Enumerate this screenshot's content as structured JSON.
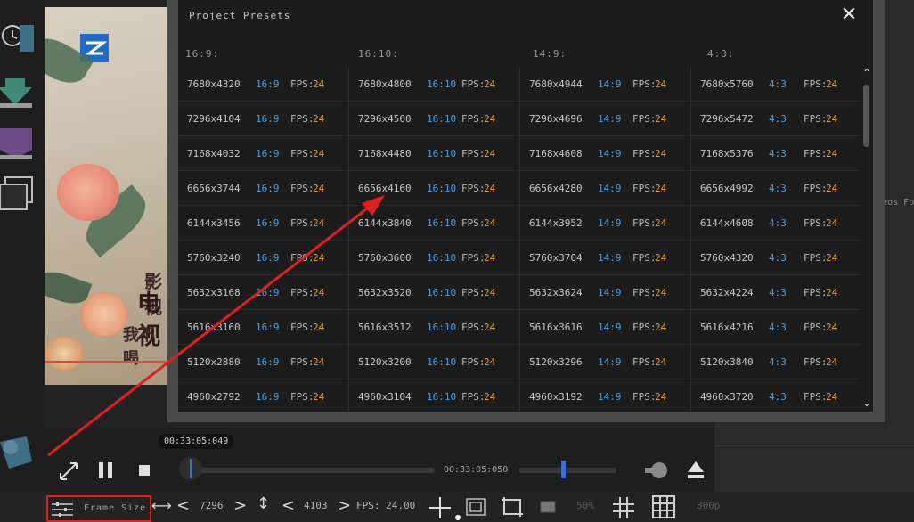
{
  "modal": {
    "title": "Project Presets",
    "close_icon": "close-icon",
    "columns": [
      "16:9:",
      "16:10:",
      "14:9:",
      "4:3:"
    ],
    "fps_label": "FPS:",
    "rows": [
      [
        [
          "7680x4320",
          "16:9",
          "24"
        ],
        [
          "7680x4800",
          "16:10",
          "24"
        ],
        [
          "7680x4944",
          "14:9",
          "24"
        ],
        [
          "7680x5760",
          "4:3",
          "24"
        ]
      ],
      [
        [
          "7296x4104",
          "16:9",
          "24"
        ],
        [
          "7296x4560",
          "16:10",
          "24"
        ],
        [
          "7296x4696",
          "14:9",
          "24"
        ],
        [
          "7296x5472",
          "4:3",
          "24"
        ]
      ],
      [
        [
          "7168x4032",
          "16:9",
          "24"
        ],
        [
          "7168x4480",
          "16:10",
          "24"
        ],
        [
          "7168x4608",
          "14:9",
          "24"
        ],
        [
          "7168x5376",
          "4:3",
          "24"
        ]
      ],
      [
        [
          "6656x3744",
          "16:9",
          "24"
        ],
        [
          "6656x4160",
          "16:10",
          "24"
        ],
        [
          "6656x4280",
          "14:9",
          "24"
        ],
        [
          "6656x4992",
          "4:3",
          "24"
        ]
      ],
      [
        [
          "6144x3456",
          "16:9",
          "24"
        ],
        [
          "6144x3840",
          "16:10",
          "24"
        ],
        [
          "6144x3952",
          "14:9",
          "24"
        ],
        [
          "6144x4608",
          "4:3",
          "24"
        ]
      ],
      [
        [
          "5760x3240",
          "16:9",
          "24"
        ],
        [
          "5760x3600",
          "16:10",
          "24"
        ],
        [
          "5760x3704",
          "14:9",
          "24"
        ],
        [
          "5760x4320",
          "4:3",
          "24"
        ]
      ],
      [
        [
          "5632x3168",
          "16:9",
          "24"
        ],
        [
          "5632x3520",
          "16:10",
          "24"
        ],
        [
          "5632x3624",
          "14:9",
          "24"
        ],
        [
          "5632x4224",
          "4:3",
          "24"
        ]
      ],
      [
        [
          "5616x3160",
          "16:9",
          "24"
        ],
        [
          "5616x3512",
          "16:10",
          "24"
        ],
        [
          "5616x3616",
          "14:9",
          "24"
        ],
        [
          "5616x4216",
          "4:3",
          "24"
        ]
      ],
      [
        [
          "5120x2880",
          "16:9",
          "24"
        ],
        [
          "5120x3200",
          "16:10",
          "24"
        ],
        [
          "5120x3296",
          "14:9",
          "24"
        ],
        [
          "5120x3840",
          "4:3",
          "24"
        ]
      ],
      [
        [
          "4960x2792",
          "16:9",
          "24"
        ],
        [
          "4960x3104",
          "16:10",
          "24"
        ],
        [
          "4960x3192",
          "14:9",
          "24"
        ],
        [
          "4960x3720",
          "4:3",
          "24"
        ]
      ]
    ]
  },
  "video": {
    "overlay_text_1": "影视",
    "overlay_text_2": "电视",
    "overlay_text_3": "我不喝"
  },
  "right_panel": {
    "hint": "ideos Fo"
  },
  "transport": {
    "current_time": "00:33:05:049",
    "end_time": "00:33:05:050",
    "play_head_fraction": 0.04,
    "volume_fraction": 0.45
  },
  "bottom_bar": {
    "frame_size_label": "Frame Size",
    "width_value": "7296",
    "height_value": "4103",
    "fps_text": "FPS: 24.00",
    "zoom_text": "50%",
    "quality_text": "300p"
  },
  "colors": {
    "accent_blue": "#4a9ee0",
    "fps_orange": "#e6a328",
    "annotation_red": "#e02020"
  }
}
